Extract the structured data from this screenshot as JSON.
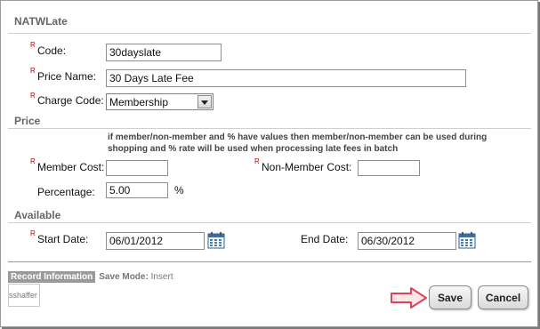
{
  "form": {
    "title": "NATWLate",
    "required_marker": "R",
    "code": {
      "label": "Code:",
      "value": "30dayslate"
    },
    "price_name": {
      "label": "Price Name:",
      "value": "30 Days Late Fee"
    },
    "charge_code": {
      "label": "Charge Code:",
      "value": "Membership"
    }
  },
  "price": {
    "section": "Price",
    "note": "if member/non-member and % have values then member/non-member can be used during shopping and % rate will be used when processing late fees in batch",
    "member_cost": {
      "label": "Member Cost:",
      "value": ""
    },
    "non_member_cost": {
      "label": "Non-Member Cost:",
      "value": ""
    },
    "percentage": {
      "label": "Percentage:",
      "value": "5.00",
      "unit": "%"
    }
  },
  "available": {
    "section": "Available",
    "start_date": {
      "label": "Start Date:",
      "value": "06/01/2012"
    },
    "end_date": {
      "label": "End Date:",
      "value": "06/30/2012"
    }
  },
  "footer": {
    "record_info": "Record Information",
    "save_mode_label": "Save Mode:",
    "save_mode_value": "Insert",
    "user": "sshaffer",
    "save_label": "Save",
    "cancel_label": "Cancel"
  },
  "colors": {
    "required": "#c00000",
    "pointer_arrow": "#e0415b"
  },
  "icons": [
    "calendar-icon",
    "pointer-arrow-icon",
    "chevron-down-icon"
  ]
}
